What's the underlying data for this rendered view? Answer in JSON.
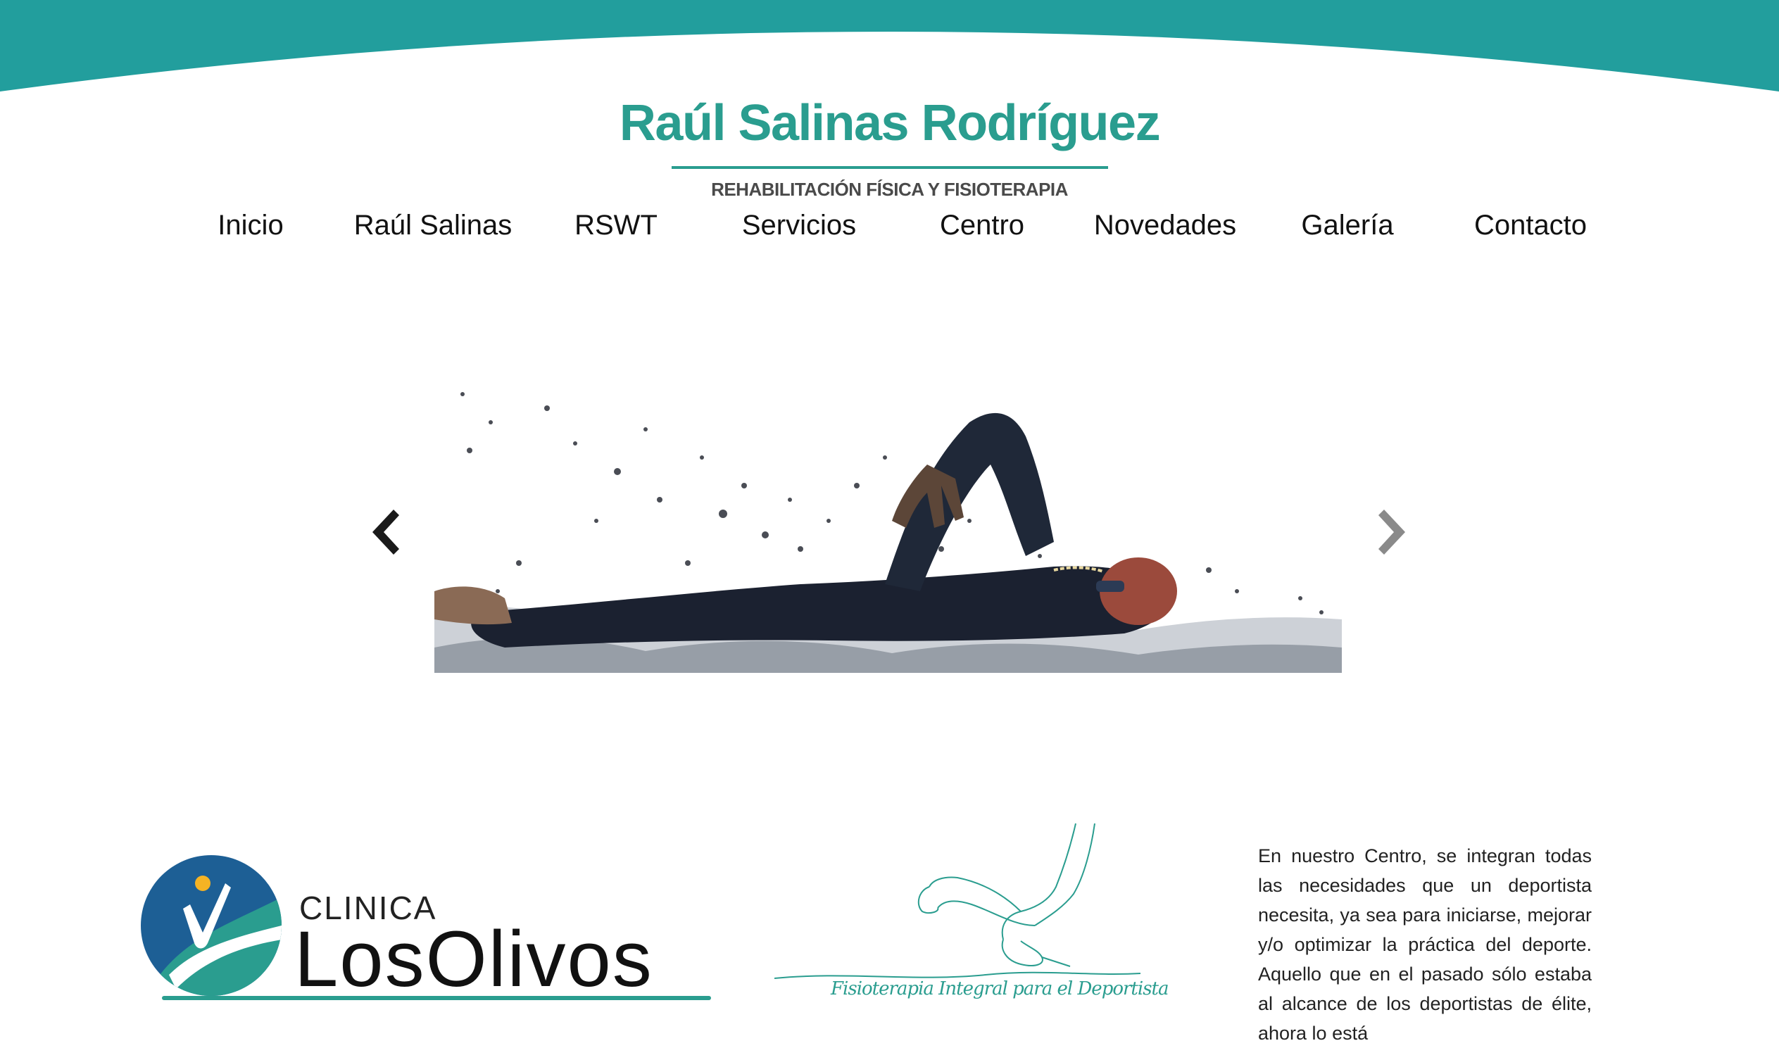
{
  "colors": {
    "brand": "#2a9d8f",
    "text": "#111111",
    "clinic_blue": "#1d5f95"
  },
  "header": {
    "title": "Raúl Salinas Rodríguez",
    "subtitle": "REHABILITACIÓN FÍSICA Y FISIOTERAPIA"
  },
  "nav": {
    "items": [
      {
        "label": "Inicio"
      },
      {
        "label": "Raúl Salinas"
      },
      {
        "label": "RSWT"
      },
      {
        "label": "Servicios"
      },
      {
        "label": "Centro"
      },
      {
        "label": "Novedades"
      },
      {
        "label": "Galería"
      },
      {
        "label": "Contacto"
      }
    ]
  },
  "slider": {
    "prev_icon": "chevron-left-icon",
    "next_icon": "chevron-right-icon"
  },
  "clinic": {
    "small": "CLINICA",
    "big": "LosOlivos"
  },
  "runner_logo": {
    "caption": "Fisioterapia Integral para el Deportista"
  },
  "intro": {
    "text": "En nuestro Centro, se integran todas las necesidades que un deportista necesita, ya sea para iniciarse, mejorar y/o optimizar la práctica del deporte. Aquello que en el pasado sólo estaba al alcance de los deportistas de élite, ahora lo está"
  }
}
